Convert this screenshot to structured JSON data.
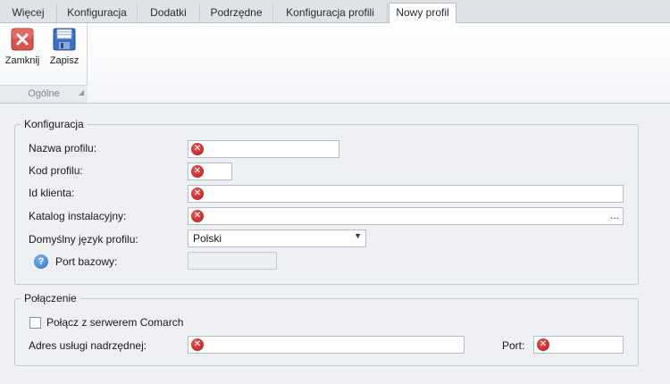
{
  "tabs": [
    {
      "label": "Więcej"
    },
    {
      "label": "Konfiguracja"
    },
    {
      "label": "Dodatki"
    },
    {
      "label": "Podrzędne"
    },
    {
      "label": "Konfiguracja profili"
    },
    {
      "label": "Nowy profil"
    }
  ],
  "ribbon": {
    "close_label": "Zamknij",
    "save_label": "Zapisz",
    "group_title": "Ogólne",
    "close_icon": "close-icon",
    "save_icon": "floppy-disk-icon"
  },
  "config": {
    "legend": "Konfiguracja",
    "profile_name_label": "Nazwa profilu:",
    "profile_name_value": "",
    "profile_code_label": "Kod profilu:",
    "profile_code_value": "",
    "client_id_label": "Id klienta:",
    "client_id_value": "",
    "install_dir_label": "Katalog instalacyjny:",
    "install_dir_value": "",
    "browse_label": "...",
    "language_label": "Domyślny język profilu:",
    "language_value": "Polski",
    "base_port_label": "Port bazowy:",
    "base_port_value": ""
  },
  "connection": {
    "legend": "Połączenie",
    "connect_checkbox_label": "Połącz z serwerem Comarch",
    "connect_checked": false,
    "parent_address_label": "Adres usługi nadrzędnej:",
    "parent_address_value": "",
    "port_label": "Port:",
    "port_value": ""
  },
  "colors": {
    "error": "#c42020",
    "accent": "#2f6fc2"
  }
}
